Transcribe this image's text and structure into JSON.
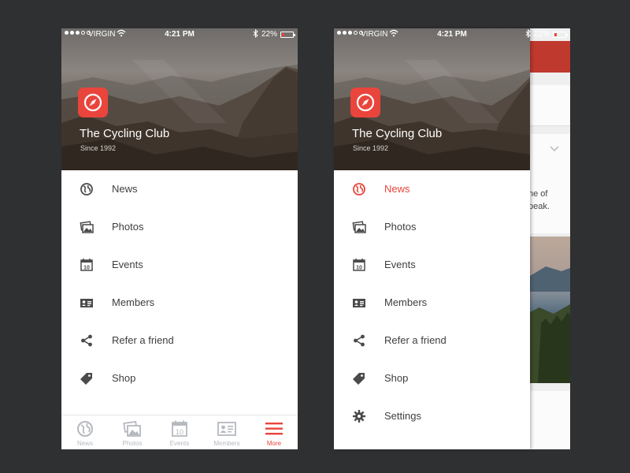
{
  "status": {
    "carrier": "VIRGIN",
    "time": "4:21 PM",
    "battery_pct": "22%",
    "battery_level": 0.22
  },
  "header": {
    "title": "The Cycling Club",
    "since": "Since 1992"
  },
  "menu_left": [
    {
      "label": "News",
      "icon": "globe-icon"
    },
    {
      "label": "Photos",
      "icon": "photos-icon"
    },
    {
      "label": "Events",
      "icon": "calendar-icon"
    },
    {
      "label": "Members",
      "icon": "id-card-icon"
    },
    {
      "label": "Refer a friend",
      "icon": "share-icon"
    },
    {
      "label": "Shop",
      "icon": "tag-icon"
    }
  ],
  "menu_right": [
    {
      "label": "News",
      "icon": "globe-icon",
      "active": true
    },
    {
      "label": "Photos",
      "icon": "photos-icon"
    },
    {
      "label": "Events",
      "icon": "calendar-icon"
    },
    {
      "label": "Members",
      "icon": "id-card-icon"
    },
    {
      "label": "Refer a friend",
      "icon": "share-icon"
    },
    {
      "label": "Shop",
      "icon": "tag-icon"
    },
    {
      "label": "Settings",
      "icon": "gear-icon"
    }
  ],
  "tabbar": [
    {
      "label": "News",
      "icon": "globe-icon"
    },
    {
      "label": "Photos",
      "icon": "photos-icon"
    },
    {
      "label": "Events",
      "icon": "calendar-icon"
    },
    {
      "label": "Members",
      "icon": "id-card-icon"
    },
    {
      "label": "More",
      "icon": "menu-icon",
      "active": true
    }
  ],
  "calendar_day": "10",
  "peek": {
    "line1": "ne of",
    "line2": "peak."
  },
  "colors": {
    "accent": "#e9453c",
    "text": "#3e3e3e",
    "icon": "#4a4a4a",
    "tab_inactive": "#b5b9bf",
    "background": "#2f3032"
  }
}
